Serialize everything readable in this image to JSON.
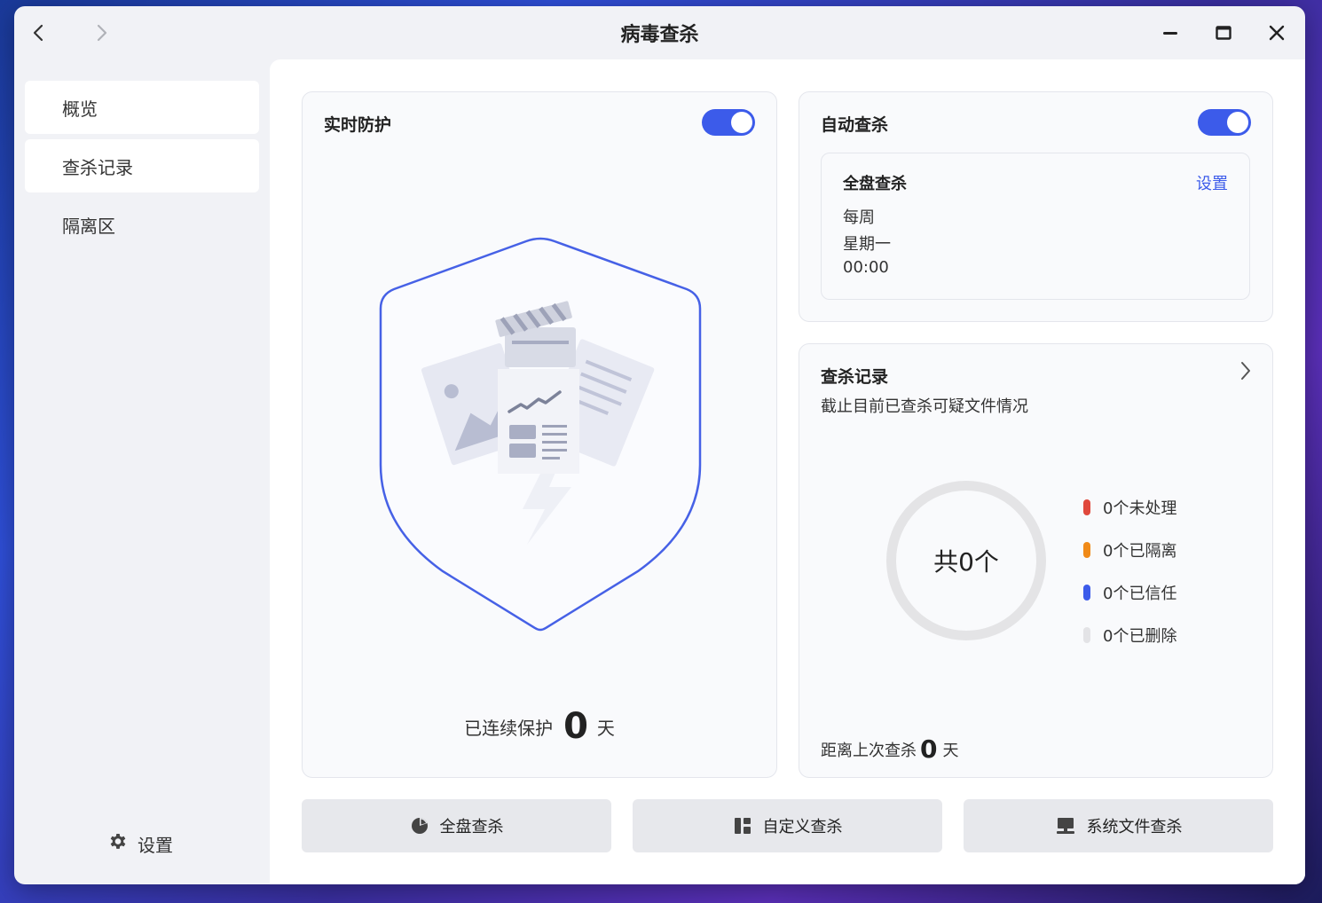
{
  "window": {
    "title": "病毒查杀"
  },
  "sidebar": {
    "items": [
      {
        "label": "概览"
      },
      {
        "label": "查杀记录"
      },
      {
        "label": "隔离区"
      }
    ],
    "settings_label": "设置"
  },
  "realtime": {
    "title": "实时防护",
    "enabled": true,
    "protect_prefix": "已连续保护",
    "protect_days": "0",
    "protect_unit": "天"
  },
  "auto_scan": {
    "title": "自动查杀",
    "enabled": true,
    "card_title": "全盘查杀",
    "settings_link": "设置",
    "frequency": "每周",
    "weekday": "星期一",
    "time": "00:00"
  },
  "records": {
    "title": "查杀记录",
    "subtitle": "截止目前已查杀可疑文件情况",
    "total": "共0个",
    "legend": [
      {
        "label": "0个未处理",
        "color": "#e0483c"
      },
      {
        "label": "0个已隔离",
        "color": "#f08a18"
      },
      {
        "label": "0个已信任",
        "color": "#3c5bea"
      },
      {
        "label": "0个已删除",
        "color": "#e3e3e6"
      }
    ],
    "last_prefix": "距离上次查杀",
    "last_days": "0",
    "last_unit": "天"
  },
  "actions": {
    "full": "全盘查杀",
    "custom": "自定义查杀",
    "system": "系统文件查杀"
  },
  "colors": {
    "accent": "#3c5bea"
  }
}
